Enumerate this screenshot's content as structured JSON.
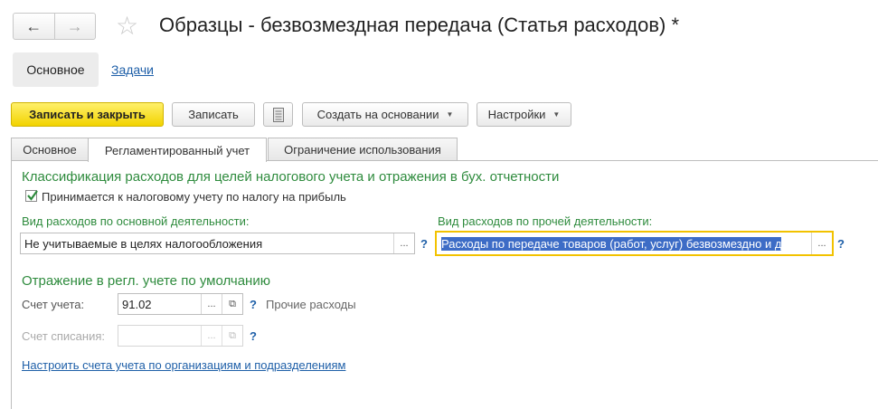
{
  "window": {
    "title": "Образцы - безвозмездная передача (Статья расходов) *",
    "back_icon": "arrow-left-icon",
    "forward_icon": "arrow-right-icon",
    "favorite_icon": "star-icon"
  },
  "sections": {
    "main": "Основное",
    "tasks": "Задачи"
  },
  "toolbar": {
    "save_close": "Записать и закрыть",
    "save": "Записать",
    "report_icon": "report-icon",
    "create_based_on": "Создать на основании",
    "settings": "Настройки"
  },
  "tabs": [
    {
      "label": "Основное",
      "active": false
    },
    {
      "label": "Регламентированный учет",
      "active": true
    },
    {
      "label": "Ограничение использования",
      "active": false
    }
  ],
  "classification": {
    "heading": "Классификация расходов для целей налогового учета и отражения в бух. отчетности",
    "accepted_checkbox_label": "Принимается к налоговому учету по налогу на прибыль",
    "accepted_checked": true,
    "main_activity_label": "Вид расходов по основной деятельности:",
    "main_activity_value": "Не учитываемые в целях налогообложения",
    "other_activity_label": "Вид расходов по прочей деятельности:",
    "other_activity_value": "Расходы по передаче товаров (работ, услуг) безвозмездно и д",
    "select_button": "...",
    "help": "?"
  },
  "accounting": {
    "heading": "Отражение в регл. учете по умолчанию",
    "account_label": "Счет учета:",
    "account_value": "91.02",
    "account_description": "Прочие расходы",
    "writeoff_label": "Счет списания:",
    "writeoff_value": "",
    "open_icon": "open-window-icon",
    "configure_link": "Настроить счета учета по организациям и подразделениям"
  },
  "colors": {
    "accent_green": "#2e8b3d",
    "link_blue": "#1e5fa8",
    "primary_button": "#f2d300",
    "selection": "#3d6cc6",
    "focus_border": "#f2c200"
  }
}
